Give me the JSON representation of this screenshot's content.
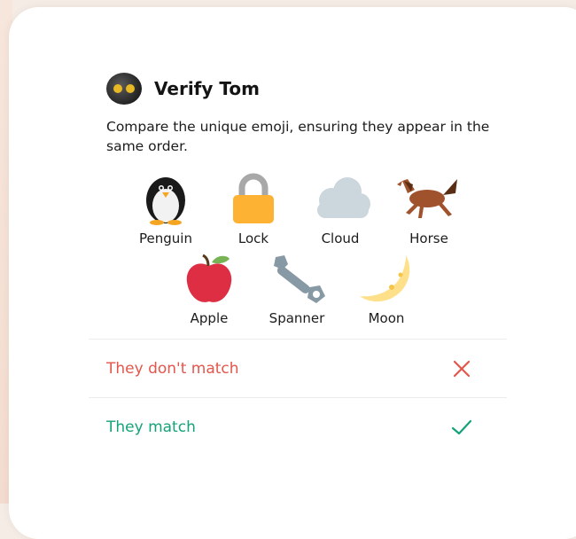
{
  "dialog": {
    "title": "Verify Tom",
    "description": "Compare the unique emoji, ensuring they appear in the same order."
  },
  "emojis": [
    {
      "label": "Penguin",
      "icon": "penguin-icon"
    },
    {
      "label": "Lock",
      "icon": "lock-icon"
    },
    {
      "label": "Cloud",
      "icon": "cloud-icon"
    },
    {
      "label": "Horse",
      "icon": "horse-icon"
    },
    {
      "label": "Apple",
      "icon": "apple-icon"
    },
    {
      "label": "Spanner",
      "icon": "spanner-icon"
    },
    {
      "label": "Moon",
      "icon": "moon-icon"
    }
  ],
  "actions": {
    "no_match": "They don't match",
    "match": "They match"
  },
  "colors": {
    "no_match": "#e5554b",
    "match": "#15a27a"
  }
}
